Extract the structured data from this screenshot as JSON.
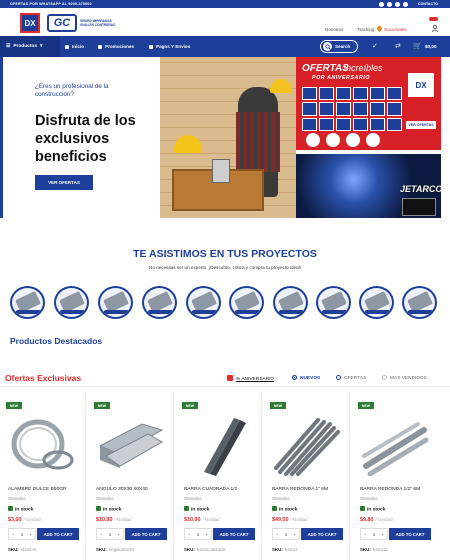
{
  "topbar": {
    "promo": "OFERTAS POR WHATSAPP AL 9000-370000",
    "contact": "CONTACTO"
  },
  "header": {
    "logo1_text": "DX",
    "logo2_text": "GC",
    "brand_text": "GRUPO IMPERADAS GUILLEN CONTRERAS",
    "links": {
      "nosotros": "Nosotros",
      "tracking": "Tracking",
      "sucursales": "Sucursales"
    }
  },
  "nav": {
    "products": "Productos",
    "inicio": "Inicio",
    "promociones": "Promociones",
    "pagos": "Pagos Y Envios",
    "search": "Search",
    "cart_count": "0",
    "cart_total": "$0,00"
  },
  "hero": {
    "question": "¿Eres un profesional de la construcción?",
    "headline": "Disfruta de los exclusivos beneficios",
    "cta": "VER OFERTAS",
    "promo_right_top": {
      "ofertas": "OFERTAS",
      "increibles": "increíbles",
      "aniversario": "POR ANIVERSARIO",
      "logo": "DX",
      "ver": "VER OFERTAS"
    },
    "promo_right_bottom": {
      "brand": "JETARCO"
    }
  },
  "section_assist": {
    "title": "TE ASISTIMOS EN TUS PROYECTOS",
    "subtitle": "No necesitas ser un experto. ¡Descubre, cotiza y compra tu proyecto ideal!",
    "categories_count": 10
  },
  "featured_title": "Productos Destacados",
  "offers": {
    "title": "Ofertas Exclusivas",
    "tabs": [
      "% ANIVERSARIO",
      "NUEVOS",
      "OFERTAS",
      "MAS VENDIDOS"
    ],
    "active_tab": "NUEVOS"
  },
  "products": [
    {
      "badge": "NEW",
      "name": "ALAMBRE DULCE B50GR",
      "brand": "Generico",
      "stock_label": "In stock",
      "price": "$3,00",
      "unit": "/ Unidad",
      "add": "ADD TO CART",
      "sku_label": "SKU:",
      "sku": "alambre"
    },
    {
      "badge": "NEW",
      "name": "ANGULO 30X30 40X40",
      "brand": "Generico",
      "stock_label": "In stock",
      "price": "$10,90",
      "unit": "/ Unidad",
      "add": "ADD TO CART",
      "sku_label": "SKU:",
      "sku": "angulo30x30"
    },
    {
      "badge": "NEW",
      "name": "BARRA CUADRADA 1/2",
      "brand": "Generico",
      "stock_label": "In stock",
      "price": "$10,90",
      "unit": "/ Unidad",
      "add": "ADD TO CART",
      "sku_label": "SKU:",
      "sku": "barracuadrada"
    },
    {
      "badge": "NEW",
      "name": "BARRA REDONDA 1\" 6M",
      "brand": "Generico",
      "stock_label": "In stock",
      "price": "$49,00",
      "unit": "/ Unidad",
      "add": "ADD TO CART",
      "sku_label": "SKU:",
      "sku": "barra1"
    },
    {
      "badge": "NEW",
      "name": "BARRA REDONDA 1/2\" 6M",
      "brand": "Generico",
      "stock_label": "In stock",
      "price": "$9,80",
      "unit": "/ Unidad",
      "add": "ADD TO CART",
      "sku_label": "SKU:",
      "sku": "barra12"
    }
  ],
  "qty_default": "1"
}
